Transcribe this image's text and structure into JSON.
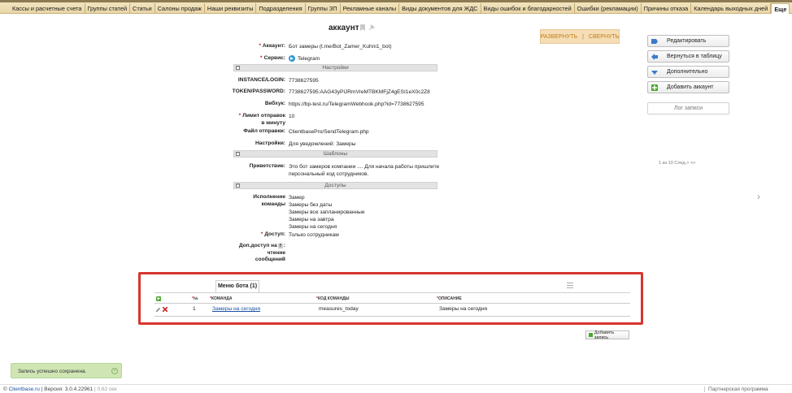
{
  "topnav": {
    "items": [
      "Кассы и расчетные счета",
      "Группы статей",
      "Статьи",
      "Салоны продаж",
      "Наши реквизиты",
      "Подразделения",
      "Группы ЗП",
      "Рекламные каналы",
      "Виды документов для ЖДС",
      "Виды ошибок и благодарностей",
      "Ошибки (рекламации)",
      "Причины отказа",
      "Календарь выходных дней",
      "Еще"
    ]
  },
  "card": {
    "title": "аккаунт",
    "expand_label": "РАЗВЕРНУТЬ",
    "separator": "|",
    "collapse_label": "СВЕРНУТЬ"
  },
  "fields": {
    "account": {
      "label": "Аккаунт:",
      "value": "Бот замеры (t.me/Bot_Zamer_Kuhni1_bot)"
    },
    "service": {
      "label": "Сервис:",
      "value": "Telegram"
    },
    "settings_section": "Настройки",
    "instance": {
      "label": "INSTANCE/LOGIN:",
      "value": "7738627595"
    },
    "token": {
      "label": "TOKEN/PASSWORD:",
      "value": "7738627595:AAG43yPlJRmVreMTBKMFjZ4gESI1eX0c2Z8"
    },
    "webhook": {
      "label": "Вебхук:",
      "value": "https://bp-test.ru/TelegramWebhook.php?id=7738627595"
    },
    "send_limit": {
      "label_line1": "Лимит отправок",
      "label_line2": "в минуту",
      "value": "10"
    },
    "send_file": {
      "label": "Файл отправки:",
      "value": "ClientbasePro/SendTelegram.php"
    },
    "settings": {
      "label": "Настройки:",
      "value": "Для уведомлений: Замеры"
    },
    "templates_section": "Шаблоны",
    "greeting": {
      "label": "Приветствие:",
      "line1": "Это бот замеров компании .... Для начала работы пришлите",
      "line2": "персональный код сотрудников."
    },
    "access_section": "Доступы",
    "executor_commands": {
      "label_line1": "Исполнение",
      "label_line2": "команды",
      "values": [
        "Замер",
        "Замеры без даты",
        "Замеры все запланированные",
        "Замеры на завтра",
        "Замеры на сегодня"
      ]
    },
    "access": {
      "label": "Доступ:",
      "value": "Только сотрудникам"
    },
    "extra_access": {
      "label_line1": "Доп.доступ на",
      "label_line2": "чтение",
      "label_line3": "сообщений"
    }
  },
  "sidebar": {
    "edit": "Редактировать",
    "back": "Вернуться в таблицу",
    "more": "Дополнительно",
    "add_account": "Добавить аккаунт",
    "log": "Лог записи",
    "pager": "1 из 10 След.> >>"
  },
  "subtable": {
    "tab_label": "Меню бота (1)",
    "headers": [
      "№",
      "КОМАНДА",
      "КОД КОМАНДЫ",
      "ОПИСАНИЕ"
    ],
    "rows": [
      {
        "num": "1",
        "command": "Замеры на сегодня",
        "code": "measures_today",
        "description": "Замеры на сегодня"
      }
    ],
    "add_record": "Добавить запись"
  },
  "toast": {
    "message": "Запись успешно сохранена."
  },
  "footer": {
    "brand": "Clientbase.ru",
    "version": "| Версия: 3.0.4.22961",
    "time": "| 0.62 сек",
    "partner": "Партнерская программа"
  },
  "colors": {
    "topbar": "#f4e7c4",
    "accent_link": "#c47a10",
    "highlight_box": "#d6362d",
    "toast_bg": "#cfe6b4"
  }
}
